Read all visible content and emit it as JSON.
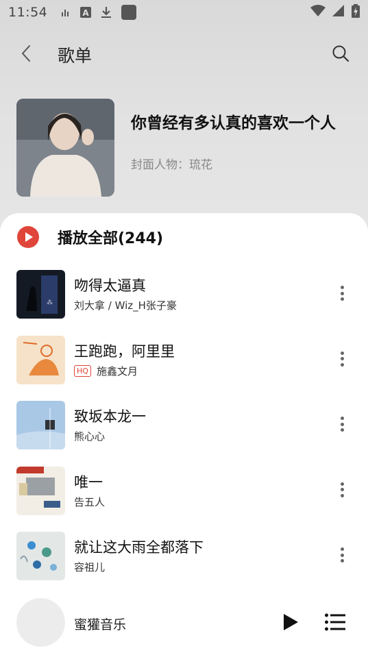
{
  "status_bar": {
    "time": "11:54",
    "icons": [
      "signal-bars-icon",
      "font-a-icon",
      "download-icon",
      "app-square-icon",
      "wifi-icon",
      "cell-signal-icon",
      "battery-charging-icon"
    ]
  },
  "header": {
    "title": "歌单",
    "back_icon": "chevron-left-icon",
    "search_icon": "search-icon"
  },
  "playlist": {
    "name": "你曾经有多认真的喜欢一个人",
    "cover_person": "封面人物：琉花"
  },
  "play_all": {
    "label": "播放全部(244)"
  },
  "songs": [
    {
      "title": "吻得太逼真",
      "artist": "刘大拿 / Wiz_H张子豪",
      "hq": false,
      "art_color": "#1c2430"
    },
    {
      "title": "王跑跑，阿里里",
      "artist": "施鑫文月",
      "hq": true,
      "hq_label": "HQ",
      "art_color": "#f4d9b8"
    },
    {
      "title": "致坂本龙一",
      "artist": "熊心心",
      "hq": false,
      "art_color": "#9ec1e0"
    },
    {
      "title": "唯一",
      "artist": "告五人",
      "hq": false,
      "art_color": "#efe9dc"
    },
    {
      "title": "就让这大雨全都落下",
      "artist": "容祖儿",
      "hq": false,
      "art_color": "#dfe3e2"
    }
  ],
  "mini_player": {
    "title": "蜜獾音乐",
    "play_icon": "play-icon",
    "list_icon": "playlist-icon"
  },
  "colors": {
    "accent": "#e0453a",
    "background": "#e4e4e4",
    "sheet": "#ffffff"
  }
}
